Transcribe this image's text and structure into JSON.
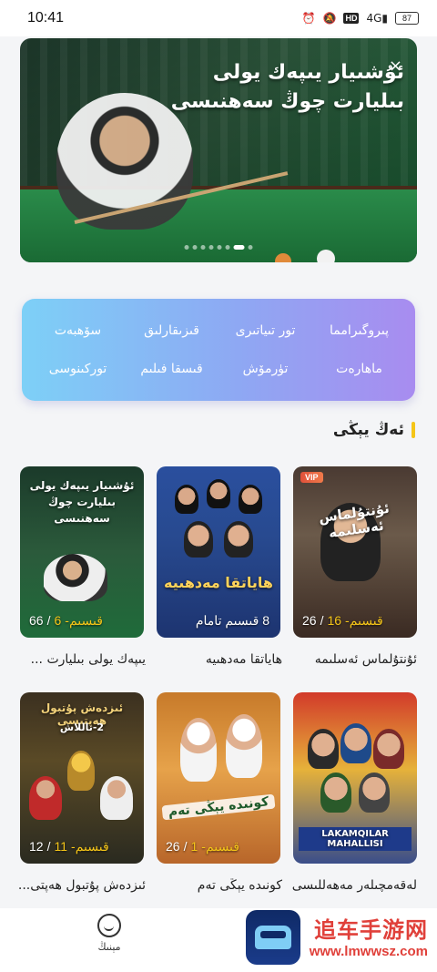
{
  "status": {
    "time": "10:41",
    "network": "4G",
    "battery": "87"
  },
  "banner": {
    "title_line1": "ئۇشىيار يىپەك يولى",
    "title_line2": "بىليارت چوڭ سەھنىسى",
    "close": "×",
    "dot_count": 8,
    "active_dot": 6
  },
  "categories": [
    "پىروگىرامما",
    "تور تىياتىرى",
    "قىزىقارلىق",
    "سۆھبەت",
    "ماھارەت",
    "تۈرمۆش",
    "قىسقا فىلىم",
    "توركىنوسى"
  ],
  "section": {
    "title": "ئەڭ يېڭى"
  },
  "cards": [
    {
      "title": "ئۇنتۇلماس ئەسلىمە",
      "poster": "ئۇنتۇلماس ئەسلىمە",
      "ep_total": "26",
      "ep_current": "16",
      "ep_suffix": "-قىسىم",
      "vip": "VIP"
    },
    {
      "title": "ھاياتقا مەدھىيە",
      "poster": "ھاياتقا مەدھىيە",
      "status": "8 قىسىم تامام"
    },
    {
      "title": "يىپەك يولى بىليارت ...",
      "poster": "ئۇشىيار يىپەك يولى بىليارت چوڭ سەھنىسى",
      "ep_total": "66",
      "ep_current": "6",
      "ep_suffix": "-قىسىم"
    },
    {
      "title": "لەقەمچىلەر مەھەللىسى",
      "poster": "LAKAMQILAR MAHALLISI"
    },
    {
      "title": "كونىدە يېڭى تەم",
      "poster": "كونىدە يېڭى تەم",
      "ep_total": "26",
      "ep_current": "1",
      "ep_suffix": "-قىسىم"
    },
    {
      "title": "ئىزدەش پۇتبول ھەپتى...",
      "poster": "ئىزدەش پۇتبول ھەپتىسى",
      "ep_total": "12",
      "ep_current": "11",
      "ep_suffix": "-قىسىم",
      "tag": "2-تاللاش"
    }
  ],
  "bottom_nav": {
    "mine_label": "مېنىڭ",
    "watermark_main": "追车手游网",
    "watermark_sub": "www.lmwwsz.com"
  },
  "colors": {
    "accent_yellow": "#f5c518",
    "episode_highlight": "#f5c518",
    "watermark_red": "#e0403a"
  }
}
